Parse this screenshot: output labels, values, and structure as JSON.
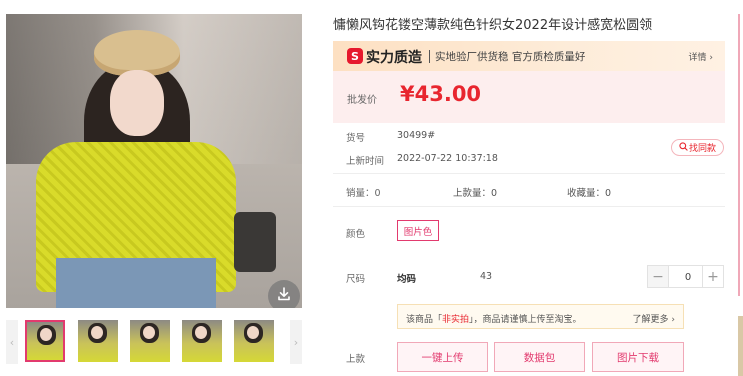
{
  "product": {
    "title": "慵懒风钩花镂空薄款纯色针织女2022年设计感宽松圆领",
    "gallery": {
      "thumbnail_count": 5,
      "active_thumbnail": 0
    }
  },
  "banner": {
    "logo_glyph": "S",
    "brand": "实力质造",
    "slogan": "实地验厂供货稳 官方质检质量好",
    "more_label": "详情 ›"
  },
  "price": {
    "label": "批发价",
    "value": "¥43.00"
  },
  "details": {
    "sku_label": "货号",
    "sku_value": "30499#",
    "listed_label": "上新时间",
    "listed_value": "2022-07-22 10:37:18",
    "find_similar": "找同款"
  },
  "stats": {
    "sales": "销量：0",
    "listings": "上款量：0",
    "favorites": "收藏量：0"
  },
  "color": {
    "label": "颜色",
    "option": "图片色"
  },
  "size": {
    "label": "尺码",
    "name": "均码",
    "stock": "43",
    "quantity": "0",
    "minus": "−",
    "plus": "+"
  },
  "notice": {
    "prefix": "该商品「",
    "highlight": "非实拍",
    "suffix": "」，商品请谨慎上传至淘宝。",
    "link": "了解更多 ›"
  },
  "actions": {
    "label": "上款",
    "upload": "一键上传",
    "data_pack": "数据包",
    "image_download": "图片下载"
  },
  "colors": {
    "accent": "#e23a6e",
    "price": "#e8262f",
    "price_bg": "#fdeeee"
  }
}
